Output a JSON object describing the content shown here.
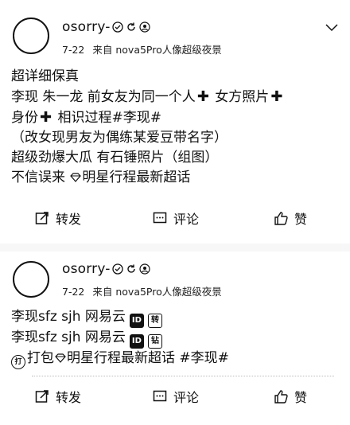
{
  "posts": [
    {
      "username": "osorry-",
      "date": "7-22",
      "source": "来自 nova5Pro人像超级夜景",
      "lines": [
        {
          "text": "超详细保真"
        },
        {
          "text": "李现 朱一龙 前女友为同一个人",
          "plus_after": true,
          "tail": " 女方照片",
          "plus_end": true
        },
        {
          "text": "身份",
          "plus_after": true,
          "tail": " 相识过程#李现#"
        },
        {
          "text": "（改女现男友为偶练某爱豆带名字）"
        },
        {
          "text": "超级劲爆大瓜 有石锤照片（组图）"
        },
        {
          "text": "不信误来 ",
          "gem": true,
          "tail": "明星行程最新超话"
        }
      ],
      "actions": {
        "repost": "转发",
        "comment": "评论",
        "like": "赞"
      }
    },
    {
      "username": "osorry-",
      "date": "7-22",
      "source": "来自 nova5Pro人像超级夜景",
      "lines": [
        {
          "text": "李现sfz  sjh 网易云",
          "icons": [
            "ID",
            "转"
          ]
        },
        {
          "text": "李现sfz  sjh 网易云",
          "icons": [
            "ID",
            "钻"
          ]
        },
        {
          "prefix_icon": "打",
          "text": "打包",
          "gem": true,
          "tail": "明星行程最新超话 #李现#"
        }
      ],
      "actions": {
        "repost": "转发",
        "comment": "评论",
        "like": "赞"
      }
    }
  ]
}
